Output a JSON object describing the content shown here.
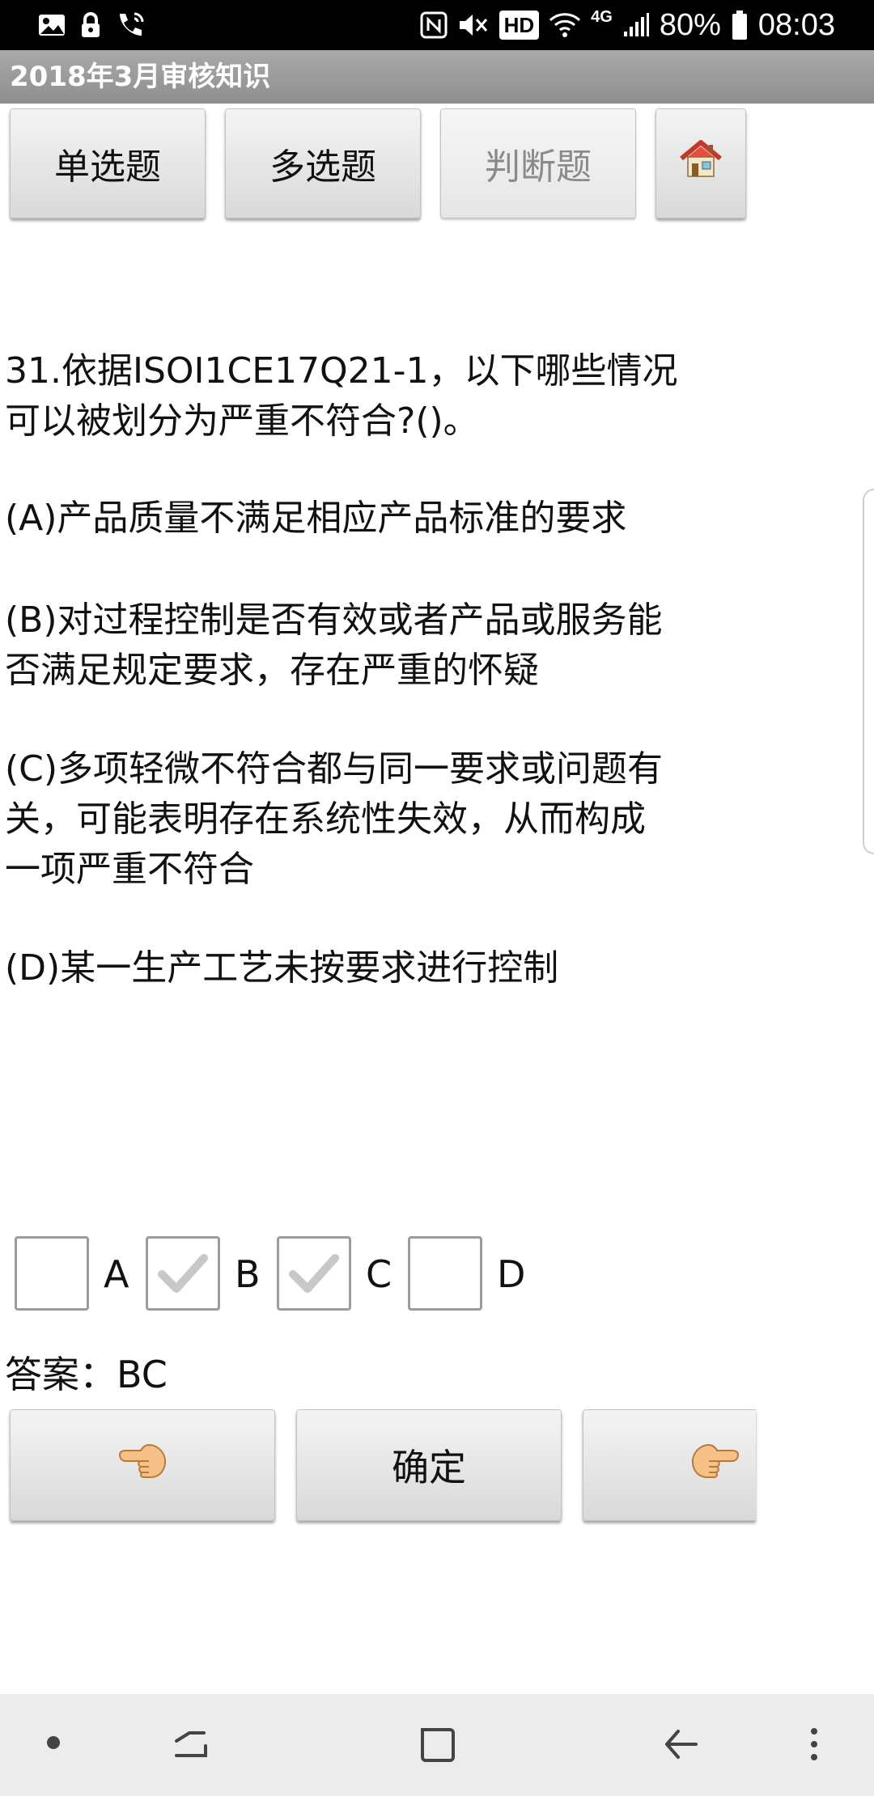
{
  "status_bar": {
    "battery": "80%",
    "time": "08:03",
    "hd": "HD",
    "network": "4G"
  },
  "titlebar": {
    "title": "2018年3月审核知识"
  },
  "tabs": [
    {
      "label": "单选题",
      "enabled": true
    },
    {
      "label": "多选题",
      "enabled": true
    },
    {
      "label": "判断题",
      "enabled": false
    }
  ],
  "home_icon": "home-icon",
  "question": {
    "stem_line1": "31.依据ISOI1CE17Q21-1，以下哪些情况",
    "stem_line2": "可以被划分为严重不符合?()。",
    "option_a": "(A)产品质量不满足相应产品标准的要求",
    "option_b_line1": "(B)对过程控制是否有效或者产品或服务能",
    "option_b_line2": "否满足规定要求，存在严重的怀疑",
    "option_c_line1": "(C)多项轻微不符合都与同一要求或问题有",
    "option_c_line2": "关，可能表明存在系统性失效，从而构成",
    "option_c_line3": "一项严重不符合",
    "option_d": "(D)某一生产工艺未按要求进行控制"
  },
  "choices": [
    {
      "label": "A",
      "checked": false
    },
    {
      "label": "B",
      "checked": true
    },
    {
      "label": "C",
      "checked": true
    },
    {
      "label": "D",
      "checked": false
    }
  ],
  "answer_text": "答案：BC",
  "bottom_buttons": {
    "prev_icon": "pointing-left-icon",
    "confirm_label": "确定",
    "next_icon": "pointing-right-icon"
  },
  "colors": {
    "titlebar": "#9b9b9b",
    "button_top": "#f4f4f4",
    "button_bottom": "#d9d9d9",
    "check_mark": "#c8c8c8",
    "navbar": "#ececec"
  }
}
